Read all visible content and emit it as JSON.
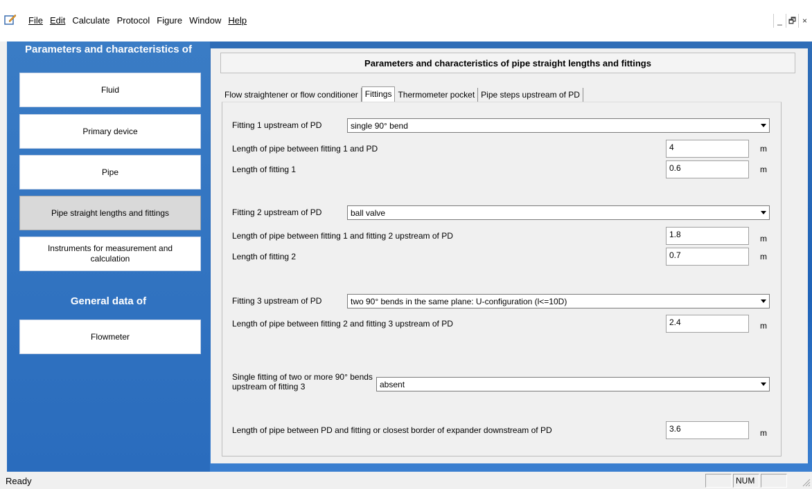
{
  "menu": [
    "File",
    "Edit",
    "Calculate",
    "Protocol",
    "Figure",
    "Window",
    "Help"
  ],
  "window_controls": {
    "minimize": "_",
    "restore": "🗗",
    "close": "×"
  },
  "left_panel": {
    "heading_params": "Parameters and characteristics of",
    "buttons": [
      "Fluid",
      "Primary device",
      "Pipe",
      "Pipe straight lengths and fittings",
      "Instruments for measurement and calculation"
    ],
    "heading_general": "General data of",
    "general_buttons": [
      "Flowmeter"
    ]
  },
  "content": {
    "title": "Parameters and characteristics of pipe straight lengths and fittings",
    "tabs": [
      "Flow straightener or flow conditioner",
      "Fittings",
      "Thermometer pocket",
      "Pipe steps upstream of PD"
    ],
    "fitting1": {
      "label": "Fitting 1 upstream of PD",
      "value": "single 90° bend",
      "len_pipe_label": "Length of pipe between fitting 1 and PD",
      "len_pipe_value": "4",
      "len_fitting_label": "Length of fitting 1",
      "len_fitting_value": "0.6"
    },
    "fitting2": {
      "label": "Fitting 2 upstream of PD",
      "value": "ball valve",
      "len_pipe_label": "Length of pipe between fitting 1 and fitting 2 upstream of PD",
      "len_pipe_value": "1.8",
      "len_fitting_label": "Length of fitting 2",
      "len_fitting_value": "0.7"
    },
    "fitting3": {
      "label": "Fitting 3 upstream of PD",
      "value": "two 90° bends in the same plane: U-configuration (l<=10D)",
      "len_pipe_label": "Length of pipe between fitting 2 and fitting 3 upstream of PD",
      "len_pipe_value": "2.4"
    },
    "single_fitting": {
      "label": "Single fitting of two or more 90° bends upstream of fitting 3",
      "value": "absent"
    },
    "downstream": {
      "label": "Length of pipe between PD and fitting or closest border of expander downstream of PD",
      "value": "3.6"
    },
    "unit": "m"
  },
  "status": {
    "text": "Ready",
    "num": "NUM"
  }
}
